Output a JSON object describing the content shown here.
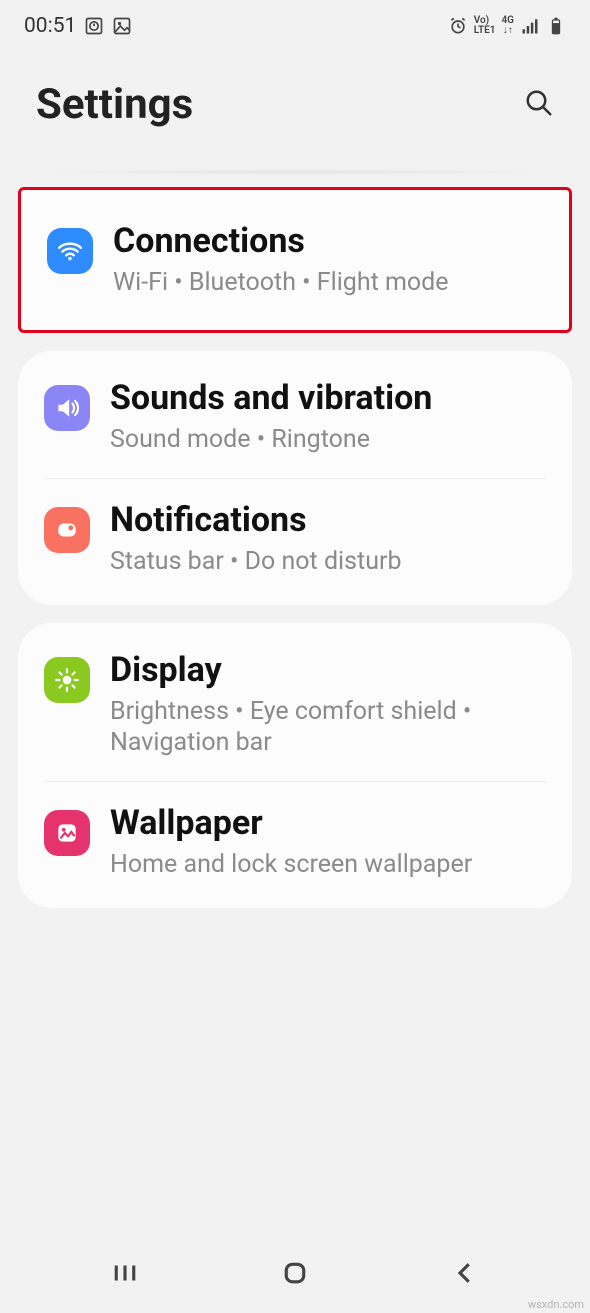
{
  "status": {
    "time": "00:51",
    "volte_top": "Vo)",
    "volte_bottom": "LTE1",
    "net": "4G"
  },
  "header": {
    "title": "Settings"
  },
  "groups": {
    "g0": {
      "connections": {
        "title": "Connections",
        "sub": "Wi‑Fi  •  Bluetooth  •  Flight mode"
      }
    },
    "g1": {
      "sounds": {
        "title": "Sounds and vibration",
        "sub": "Sound mode  •  Ringtone"
      },
      "notifications": {
        "title": "Notifications",
        "sub": "Status bar  •  Do not disturb"
      }
    },
    "g2": {
      "display": {
        "title": "Display",
        "sub": "Brightness  •  Eye comfort shield  •  Navigation bar"
      },
      "wallpaper": {
        "title": "Wallpaper",
        "sub": "Home and lock screen wallpaper"
      }
    }
  },
  "watermark": "wsxdn.com"
}
